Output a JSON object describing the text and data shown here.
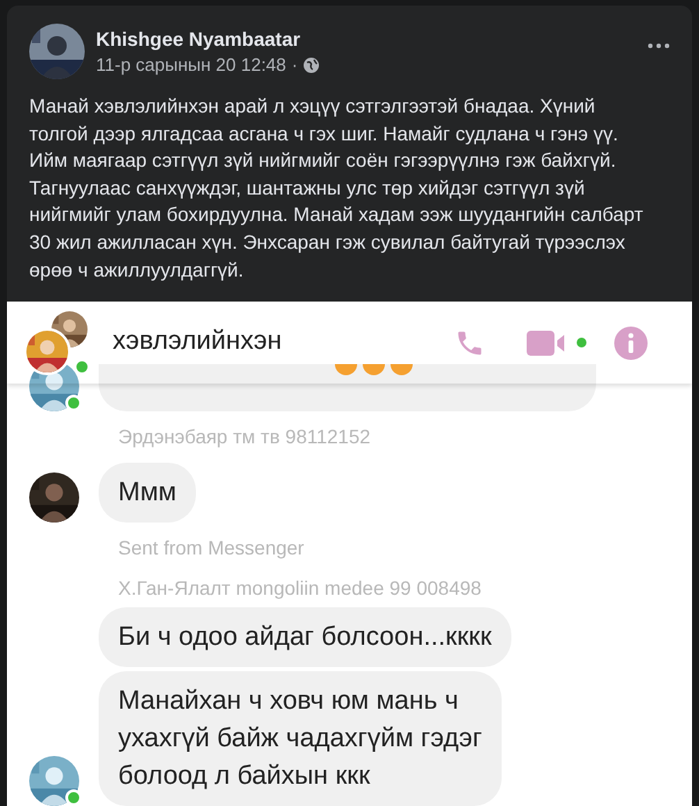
{
  "post": {
    "author": "Khishgee Nyambaatar",
    "time": "11-р сарынын 20 12:48",
    "separator": "·",
    "text": "Манай хэвлэлийнхэн арай л хэцүү сэтгэлгээтэй бнадаа. Хүний толгой дээр ялгадсаа асгана ч гэх шиг. Намайг судлана ч гэнэ үү. Ийм маягаар сэтгүүл зүй нийгмийг соён гэгээрүүлнэ гэж байхгүй. Тагнуулаас санхүүждэг, шантажны улс төр хийдэг сэтгүүл зүй нийгмийг улам бохирдуулна. Манай хадам ээж шуудангийн салбарт 30 жил ажилласан хүн. Энхсаран гэж сувилал байтугай түрээслэх өрөө ч ажиллуулдаггүй."
  },
  "chat": {
    "title": "хэвлэлийнхэн",
    "online": true,
    "video_online": true,
    "messages": [
      {
        "kind": "cut_bubble",
        "avatar": true,
        "online": true
      },
      {
        "kind": "caption",
        "text": "Эрдэнэбаяр тм тв 98112152"
      },
      {
        "kind": "bubble",
        "text": "Ммм",
        "avatar": true,
        "online": false
      },
      {
        "kind": "caption",
        "text": "Sent from Messenger"
      },
      {
        "kind": "caption",
        "text": "Х.Ган-Ялалт mongoliin medee 99 008498"
      },
      {
        "kind": "bubble",
        "text": "Би ч одоо айдаг болсоон...кккк",
        "avatar": false,
        "online": false
      },
      {
        "kind": "bubble",
        "text": "Манайхан ч ховч юм мань ч\nухахгүй байж чадахгүйм гэдэг\nболоод л байхын ккк",
        "avatar": true,
        "online": true
      }
    ]
  }
}
